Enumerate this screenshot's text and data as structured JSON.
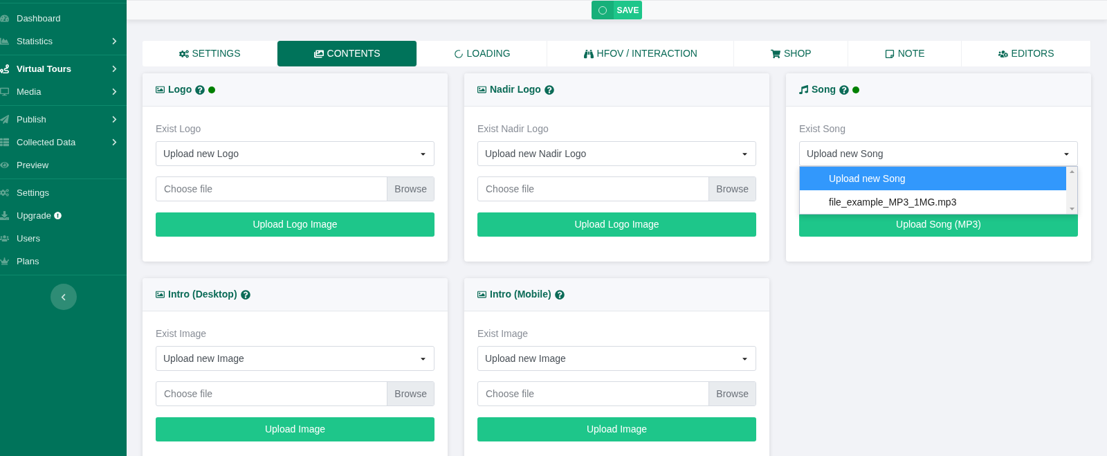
{
  "sidebar": {
    "groups": [
      {
        "items": [
          {
            "label": "Dashboard",
            "selected": false,
            "submenu": false,
            "alert": false
          },
          {
            "label": "Statistics",
            "selected": false,
            "submenu": true,
            "alert": false
          }
        ]
      },
      {
        "items": [
          {
            "label": "Virtual Tours",
            "selected": true,
            "submenu": true,
            "alert": false
          },
          {
            "label": "Media",
            "selected": false,
            "submenu": true,
            "alert": false
          }
        ]
      },
      {
        "items": [
          {
            "label": "Publish",
            "selected": false,
            "submenu": true,
            "alert": false
          },
          {
            "label": "Collected Data",
            "selected": false,
            "submenu": true,
            "alert": false
          },
          {
            "label": "Preview",
            "selected": false,
            "submenu": false,
            "alert": false
          }
        ]
      },
      {
        "items": [
          {
            "label": "Settings",
            "selected": false,
            "submenu": false,
            "alert": false
          },
          {
            "label": "Upgrade",
            "selected": false,
            "submenu": false,
            "alert": true
          },
          {
            "label": "Users",
            "selected": false,
            "submenu": false,
            "alert": false
          },
          {
            "label": "Plans",
            "selected": false,
            "submenu": false,
            "alert": false
          }
        ]
      }
    ]
  },
  "save_button": {
    "label": "SAVE",
    "on": false
  },
  "tabs": [
    {
      "label": "SETTINGS",
      "selected": false
    },
    {
      "label": "CONTENTS",
      "selected": true
    },
    {
      "label": "LOADING",
      "selected": false
    },
    {
      "label": "HFOV / INTERACTION",
      "selected": false
    },
    {
      "label": "SHOP",
      "selected": false
    },
    {
      "label": "NOTE",
      "selected": false
    },
    {
      "label": "EDITORS",
      "selected": false
    }
  ],
  "cards": [
    {
      "kind": "image",
      "title": "Logo",
      "has_file": true,
      "label": "Exist Logo",
      "select": "Upload new Logo",
      "file_field": {
        "placeholder": "Choose file",
        "button": "Browse"
      },
      "upload_button": "Upload Logo Image"
    },
    {
      "kind": "image",
      "title": "Nadir Logo",
      "has_file": false,
      "label": "Exist Nadir Logo",
      "select": "Upload new Nadir Logo",
      "file_field": {
        "placeholder": "Choose file",
        "button": "Browse"
      },
      "upload_button": "Upload Logo Image"
    },
    {
      "kind": "music",
      "title": "Song",
      "has_file": true,
      "label": "Exist Song",
      "select": "Upload new Song",
      "options": [
        {
          "label": "Upload new Song",
          "selected": true
        },
        {
          "label": "file_example_MP3_1MG.mp3",
          "selected": false
        }
      ],
      "upload_button": "Upload Song (MP3)"
    },
    {
      "kind": "image",
      "title": "Intro (Desktop)",
      "has_file": false,
      "label": "Exist Image",
      "select": "Upload new Image",
      "file_field": {
        "placeholder": "Choose file",
        "button": "Browse"
      },
      "upload_button": "Upload Image"
    },
    {
      "kind": "image",
      "title": "Intro (Mobile)",
      "has_file": false,
      "label": "Exist Image",
      "select": "Upload new Image",
      "file_field": {
        "placeholder": "Choose file",
        "button": "Browse"
      },
      "upload_button": "Upload Image"
    }
  ]
}
